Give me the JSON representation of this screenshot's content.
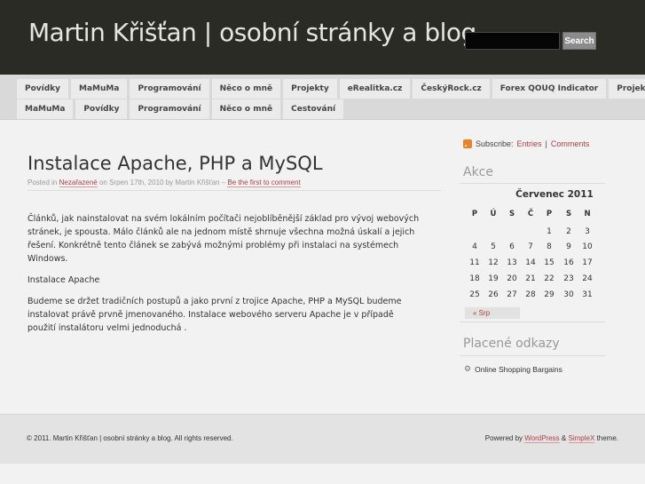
{
  "header": {
    "site_title": "Martin Křišťan | osobní stránky a blog",
    "search_placeholder": "",
    "search_button": "Search"
  },
  "nav": {
    "row1": [
      "Povídky",
      "MaMuMa",
      "Programování",
      "Něco o mně",
      "Projekty",
      "eRealitka.cz",
      "ČeskýRock.cz",
      "Forex QOUQ Indicator",
      "Projekty"
    ],
    "row2": [
      "MaMuMa",
      "Povídky",
      "Programování",
      "Něco o mně",
      "Cestování"
    ]
  },
  "post": {
    "title": "Instalace Apache, PHP a MySQL",
    "meta_posted_in": "Posted in",
    "meta_category": "Nezařazené",
    "meta_date_by": "on Srpen 17th, 2010 by Martin Křišťan –",
    "meta_comment_link": "Be the first to comment",
    "paragraphs": [
      "Článků, jak nainstalovat na svém lokálním počítači nejoblíběnější základ pro vývoj webových stránek, je spousta. Málo článků ale na jednom místě shrnuje všechna možná úskalí a jejich řešení. Konkrétně tento článek se zabývá možnými problémy při instalaci na systémech Windows.",
      "Instalace Apache",
      "Budeme se držet tradičních postupů a jako první z trojice Apache, PHP a MySQL budeme instalovat právě prvně jmenovaného. Instalace webového serveru Apache je v případě použití instalátoru velmi jednoduchá ."
    ]
  },
  "sidebar": {
    "subscribe_label": "Subscribe:",
    "entries_link": "Entries",
    "separator": "|",
    "comments_link": "Comments",
    "calendar_widget_title": "Akce",
    "calendar": {
      "caption": "Červenec 2011",
      "days": [
        "P",
        "Ú",
        "S",
        "Č",
        "P",
        "S",
        "N"
      ],
      "weeks": [
        [
          "",
          "",
          "",
          "",
          "1",
          "2",
          "3"
        ],
        [
          "4",
          "5",
          "6",
          "7",
          "8",
          "9",
          "10"
        ],
        [
          "11",
          "12",
          "13",
          "14",
          "15",
          "16",
          "17"
        ],
        [
          "18",
          "19",
          "20",
          "21",
          "22",
          "23",
          "24"
        ],
        [
          "25",
          "26",
          "27",
          "28",
          "29",
          "30",
          "31"
        ]
      ],
      "prev_link": "« Srp"
    },
    "links_widget_title": "Placené odkazy",
    "links": [
      "Online Shopping Bargains"
    ]
  },
  "footer": {
    "copyright": "© 2011. Martin Křišťan | osobní stránky a blog. All rights reserved.",
    "powered_by": "Powered by",
    "wordpress_link": "WordPress",
    "and": "&",
    "theme_link": "SimpleX",
    "theme_suffix": "theme."
  }
}
